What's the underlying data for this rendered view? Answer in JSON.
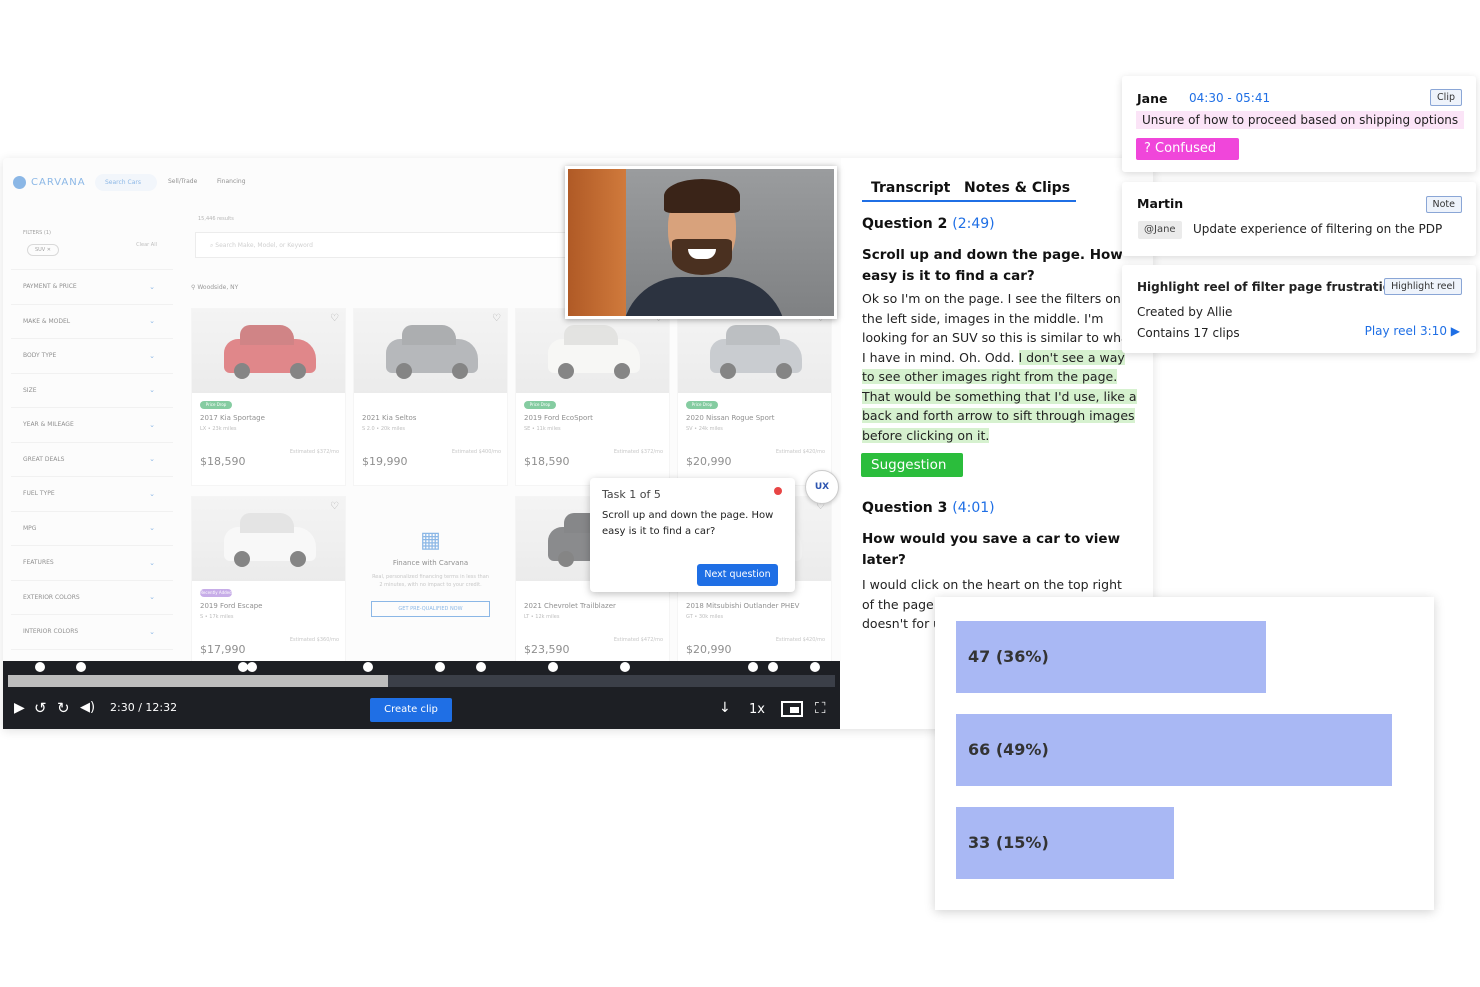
{
  "website": {
    "logo": "CARVANA",
    "search_label": "Search Cars",
    "nav": [
      "Sell/Trade",
      "Financing"
    ],
    "results_count": "15,446 results",
    "search_placeholder": "Search Make, Model, or Keyword",
    "location": "Woodside, NY",
    "filters_label": "FILTERS (1)",
    "clear_all": "Clear All",
    "chip": "SUV ✕",
    "filters": [
      "PAYMENT & PRICE",
      "MAKE & MODEL",
      "BODY TYPE",
      "SIZE",
      "YEAR & MILEAGE",
      "GREAT DEALS",
      "FUEL TYPE",
      "MPG",
      "FEATURES",
      "EXTERIOR COLORS",
      "INTERIOR COLORS"
    ],
    "cars": [
      {
        "name": "2017 Kia Sportage",
        "sub": "LX • 23k miles",
        "price": "$18,590",
        "est": "Estimated $372/mo",
        "tag": "Price Drop",
        "color": "#c8262b"
      },
      {
        "name": "2021 Kia Seltos",
        "sub": "S 2.0 • 20k miles",
        "price": "$19,990",
        "est": "Estimated $400/mo",
        "tag": "",
        "color": "#7b7f85"
      },
      {
        "name": "2019 Ford EcoSport",
        "sub": "SE • 11k miles",
        "price": "$18,590",
        "est": "Estimated $372/mo",
        "tag": "Price Drop",
        "color": "#f1f1ee"
      },
      {
        "name": "2020 Nissan Rogue Sport",
        "sub": "SV • 24k miles",
        "price": "$20,990",
        "est": "Estimated $420/mo",
        "tag": "Price Drop",
        "color": "#9ea3aa"
      },
      {
        "name": "2019 Ford Escape",
        "sub": "S • 17k miles",
        "price": "$17,990",
        "est": "Estimated $360/mo",
        "tag": "Recently Added",
        "color": "#f3f3f3"
      },
      {
        "name": "2021 Chevrolet Trailblazer",
        "sub": "LT • 12k miles",
        "price": "$23,590",
        "est": "Estimated $472/mo",
        "tag": "",
        "color": "#2b2d31"
      },
      {
        "name": "2018 Mitsubishi Outlander PHEV",
        "sub": "GT • 30k miles",
        "price": "$20,990",
        "est": "Estimated $420/mo",
        "tag": "",
        "color": "#e8e8e8"
      }
    ],
    "finance_title": "Finance with Carvana",
    "finance_sub": "Real, personalized financing terms in less than 2 minutes, with no impact to your credit.",
    "finance_button": "GET PRE-QUALIFIED NOW"
  },
  "task": {
    "counter": "Task 1 of 5",
    "question": "Scroll up and down the page. How easy is it to find a car?",
    "next_button": "Next question"
  },
  "ux_badge": "UX",
  "player": {
    "time": "2:30 / 12:32",
    "create_clip": "Create clip",
    "speed": "1x",
    "progress": 0.46
  },
  "transcript": {
    "tabs": [
      "Transcript",
      "Notes & Clips"
    ],
    "q2_label": "Question 2",
    "q2_time": "(2:49)",
    "q2_title": "Scroll up and down the page. How easy is it to find a car?",
    "q2_text_a": "Ok so I'm on the page. I see the filters on the left side, images in the middle. I'm looking for an SUV so this is similar to what I have in mind. Oh. Odd.",
    "q2_text_hl": "I don't see a way to see other images right from the page. That would be something that I'd use, like a back and forth arrow to sift through images before clicking on it.",
    "suggestion": "Suggestion",
    "q3_label": "Question 3",
    "q3_time": "(4:01)",
    "q3_title": "How would you save a car to view later?",
    "q3_text": "I would click on the heart on the top right of the page. Most companies put the heart doesn't for use in this previewing"
  },
  "clip_card": {
    "name": "Jane",
    "time": "04:30 - 05:41",
    "badge": "Clip",
    "desc": "Unsure of how to proceed based on shipping options",
    "tag": "? Confused"
  },
  "note_card": {
    "name": "Martin",
    "badge": "Note",
    "mention": "@Jane",
    "text": "Update experience of filtering on the PDP"
  },
  "reel_card": {
    "title": "Highlight reel of filter page frustrations",
    "badge": "Highlight reel",
    "created": "Created by Allie",
    "contains": "Contains 17 clips",
    "play": "Play reel 3:10 ▶"
  },
  "chart_data": {
    "type": "bar",
    "orientation": "horizontal",
    "categories": [
      "",
      "",
      ""
    ],
    "values": [
      47,
      66,
      33
    ],
    "labels": [
      "47 (36%)",
      "66 (49%)",
      "33 (15%)"
    ],
    "xlim": [
      0,
      70
    ],
    "color": "#a9b8f4",
    "grid": false,
    "title": "",
    "xlabel": "",
    "ylabel": ""
  }
}
